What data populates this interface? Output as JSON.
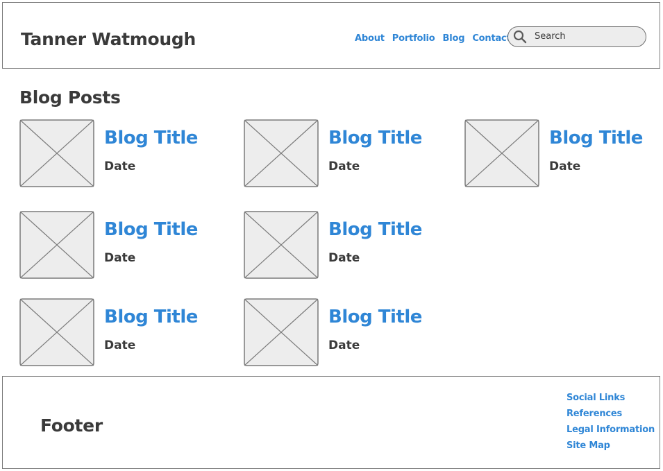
{
  "header": {
    "site_title": "Tanner Watmough",
    "nav": [
      "About",
      "Portfolio",
      "Blog",
      "Contact"
    ],
    "search": {
      "placeholder": "Search",
      "icon": "search-icon"
    }
  },
  "main": {
    "section_title": "Blog Posts",
    "posts": [
      {
        "title": "Blog Title",
        "date": "Date",
        "icon": "image-placeholder-icon"
      },
      {
        "title": "Blog Title",
        "date": "Date",
        "icon": "image-placeholder-icon"
      },
      {
        "title": "Blog Title",
        "date": "Date",
        "icon": "image-placeholder-icon"
      },
      {
        "title": "Blog Title",
        "date": "Date",
        "icon": "image-placeholder-icon"
      },
      {
        "title": "Blog Title",
        "date": "Date",
        "icon": "image-placeholder-icon"
      },
      {
        "title": "Blog Title",
        "date": "Date",
        "icon": "image-placeholder-icon"
      },
      {
        "title": "Blog Title",
        "date": "Date",
        "icon": "image-placeholder-icon"
      }
    ]
  },
  "footer": {
    "title": "Footer",
    "links": [
      "Social Links",
      "References",
      "Legal Information",
      "Site Map"
    ]
  },
  "colors": {
    "link": "#2f86d6",
    "text": "#3a3a3a",
    "border": "#7a7a7a",
    "placeholder_fill": "#ededed"
  }
}
